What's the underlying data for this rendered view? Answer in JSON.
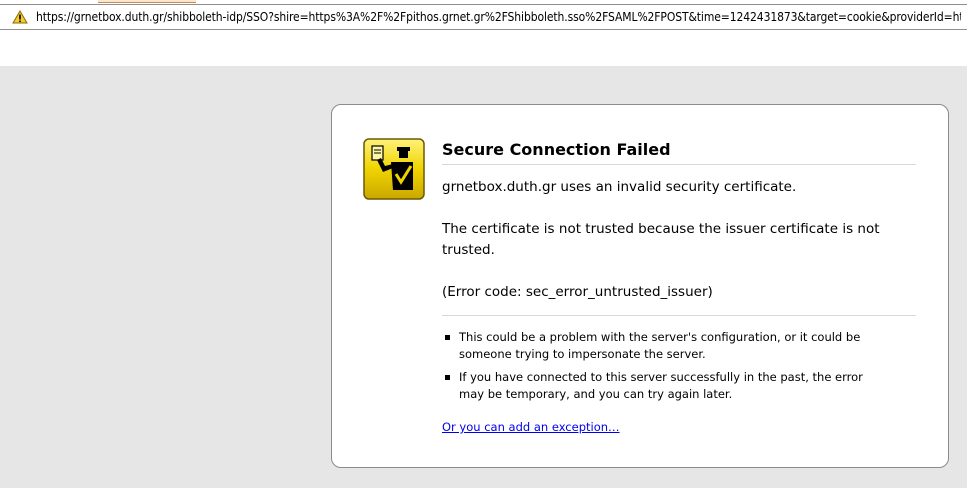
{
  "browser": {
    "url": "https://grnetbox.duth.gr/shibboleth-idp/SSO?shire=https%3A%2F%2Fpithos.grnet.gr%2FShibboleth.sso%2FSAML%2FPOST&time=1242431873&target=cookie&providerId=https%",
    "url_icon": "warning-triangle-icon"
  },
  "error_page": {
    "icon": "security-officer-icon",
    "title": "Secure Connection Failed",
    "short_desc": "grnetbox.duth.gr uses an invalid security certificate.",
    "long_desc": "The certificate is not trusted because the issuer certificate is not trusted.",
    "error_code": "(Error code: sec_error_untrusted_issuer)",
    "bullets": [
      "This could be a problem with the server's configuration, or it could be someone trying to impersonate the server.",
      "If you have connected to this server successfully in the past, the error may be temporary, and you can try again later."
    ],
    "exception_link": "Or you can add an exception…"
  },
  "colors": {
    "background": "#e6e6e6",
    "box_border": "#8b8b8b",
    "link": "#0000ee",
    "icon_yellow": "#e8c800"
  }
}
